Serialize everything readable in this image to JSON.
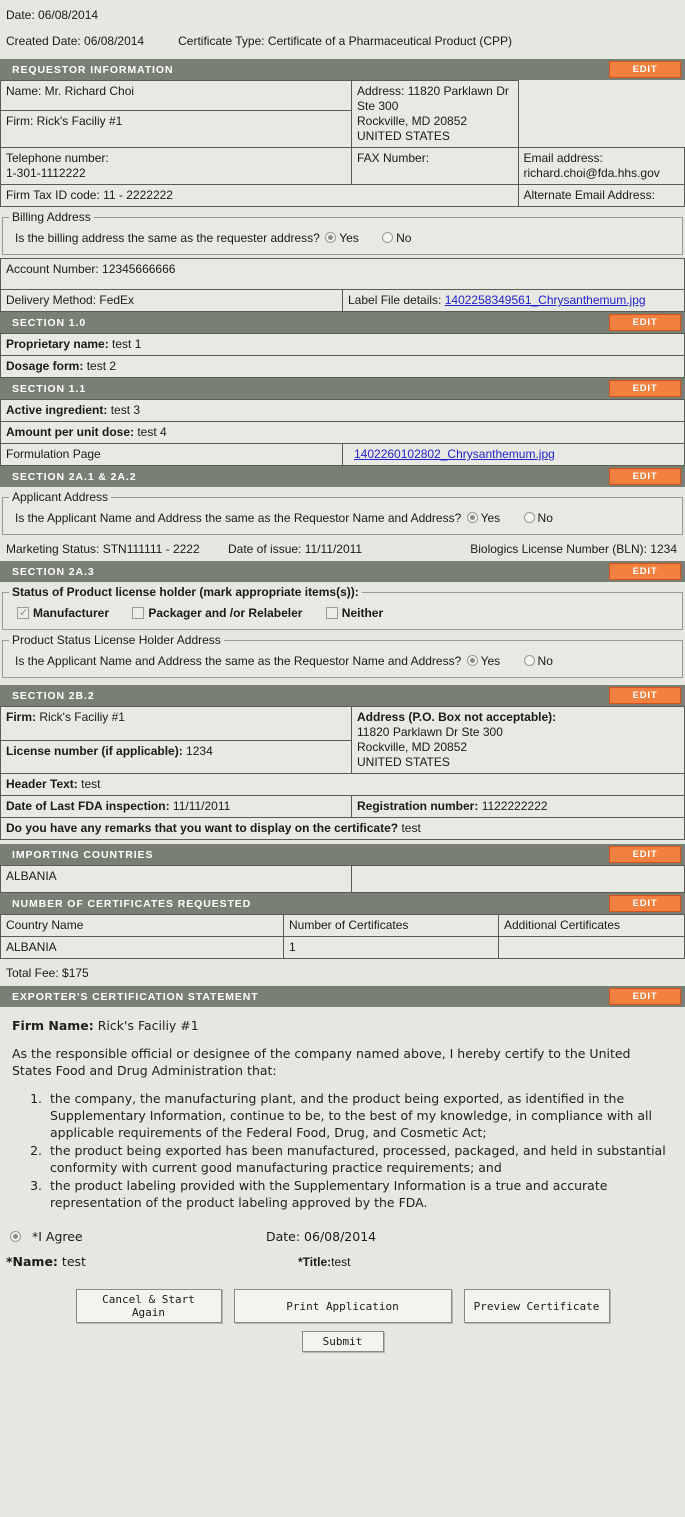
{
  "meta": {
    "date_label": "Date: 06/08/2014",
    "created_date_label": "Created Date: 06/08/2014",
    "certificate_type_label": "Certificate Type: Certificate of a Pharmaceutical Product (CPP)"
  },
  "colors": {
    "header_bar": "#7a7f74",
    "edit_button": "#f2803f",
    "edit_button_border": "#d4531b",
    "page_background": "#e6e7e1",
    "cell_background": "#e8e9e3",
    "link": "#2222cc"
  },
  "edit_label": "EDIT",
  "requestor": {
    "heading": "REQUESTOR INFORMATION",
    "name": "Name:  Mr. Richard Choi",
    "firm": "Firm: Rick's Faciliy #1",
    "address_line1": "Address: 11820 Parklawn Dr Ste 300",
    "address_line2": "Rockville, MD 20852",
    "address_line3": "UNITED STATES",
    "telephone_label": "Telephone number:",
    "telephone_value": "1-301-1112222",
    "fax_label": "FAX Number:",
    "email": "Email address: richard.choi@fda.hhs.gov",
    "firm_tax_id": "Firm Tax ID code: 11 - 2222222",
    "alternate_email": "Alternate Email Address:",
    "billing_legend": "Billing Address",
    "billing_question": "Is the billing address the same as the requester address?",
    "yes_label": "Yes",
    "no_label": "No",
    "billing_selected": "Yes",
    "account_number": "Account Number: 12345666666",
    "delivery_method": "Delivery Method: FedEx",
    "label_file_prefix": "Label File details:",
    "label_file_link": "1402258349561_Chrysanthemum.jpg"
  },
  "section_1_0": {
    "heading": "SECTION 1.0",
    "proprietary_name_label": "Proprietary name:",
    "proprietary_name_value": "test 1",
    "dosage_form_label": "Dosage form:",
    "dosage_form_value": "test 2"
  },
  "section_1_1": {
    "heading": "SECTION 1.1",
    "active_ingredient_label": "Active ingredient:",
    "active_ingredient_value": "test 3",
    "amount_per_unit_label": "Amount per unit dose:",
    "amount_per_unit_value": "test 4",
    "formulation_page_label": "Formulation Page",
    "formulation_page_link": "1402260102802_Chrysanthemum.jpg"
  },
  "section_2a12": {
    "heading": "SECTION 2A.1 & 2A.2",
    "applicant_legend": "Applicant Address",
    "applicant_question": "Is the Applicant Name and Address the same as the Requestor Name and Address?",
    "yes_label": "Yes",
    "no_label": "No",
    "applicant_selected": "Yes",
    "marketing_status": "Marketing Status: STN111111  - 2222",
    "date_of_issue": "Date of issue: 11/11/2011",
    "bln": "Biologics License Number (BLN): 1234"
  },
  "section_2a3": {
    "heading": "SECTION 2A.3",
    "status_legend": "Status of Product license holder (mark appropriate items(s)):",
    "checkboxes": [
      {
        "label": "Manufacturer",
        "checked": true
      },
      {
        "label": "Packager and /or Relabeler",
        "checked": false
      },
      {
        "label": "Neither",
        "checked": false
      }
    ],
    "holder_legend": "Product Status License Holder Address",
    "holder_question": "Is the Applicant Name and Address the same as the Requestor Name and Address?",
    "yes_label": "Yes",
    "no_label": "No",
    "holder_selected": "Yes"
  },
  "section_2b2": {
    "heading": "SECTION 2B.2",
    "firm_label": "Firm:",
    "firm_value": "Rick's Faciliy #1",
    "license_label": "License number (if applicable):",
    "license_value": "1234",
    "address_title": "Address (P.O. Box not acceptable):",
    "address_line1": "11820 Parklawn Dr Ste 300",
    "address_line2": "Rockville, MD 20852",
    "address_line3": "UNITED STATES",
    "header_text_label": "Header Text:",
    "header_text_value": "test",
    "inspection_label": "Date of Last FDA inspection:",
    "inspection_value": "11/11/2011",
    "registration_label": "Registration number:",
    "registration_value": "1122222222",
    "remarks_label": "Do you have any remarks that you want to display on the certificate?",
    "remarks_value": "test"
  },
  "importing_countries": {
    "heading": "IMPORTING COUNTRIES",
    "rows": [
      {
        "country": "ALBANIA",
        "extra": ""
      }
    ]
  },
  "certificates_requested": {
    "heading": "NUMBER OF CERTIFICATES REQUESTED",
    "columns": [
      "Country Name",
      "Number of Certificates",
      "Additional Certificates"
    ],
    "rows": [
      {
        "country": "ALBANIA",
        "number": "1",
        "additional": ""
      }
    ],
    "total_fee": "Total Fee: $175"
  },
  "certification": {
    "heading": "EXPORTER'S CERTIFICATION STATEMENT",
    "firm_name_label": "Firm Name:",
    "firm_name_value": "Rick's Faciliy #1",
    "intro": "As the responsible official or designee of the company named above, I hereby certify to the United States Food and Drug Administration that:",
    "items": [
      "the company, the manufacturing plant, and the product being exported, as identified in the Supplementary Information, continue to be, to the best of my knowledge, in compliance with all applicable requirements of the Federal Food, Drug, and Cosmetic Act;",
      "the product being exported has been manufactured, processed, packaged, and held in substantial conformity with current good manufacturing practice requirements; and",
      "the product labeling provided with the Supplementary Information is a true and accurate representation of the product labeling approved by the FDA."
    ],
    "agree_label": "*I Agree",
    "agree_selected": true,
    "date_label": "Date: 06/08/2014",
    "name_label": "*Name:",
    "name_value": "test",
    "title_label": "*Title:",
    "title_value": "test"
  },
  "buttons": {
    "cancel": "Cancel & Start Again",
    "print": "Print Application",
    "preview": "Preview Certificate",
    "submit": "Submit"
  }
}
